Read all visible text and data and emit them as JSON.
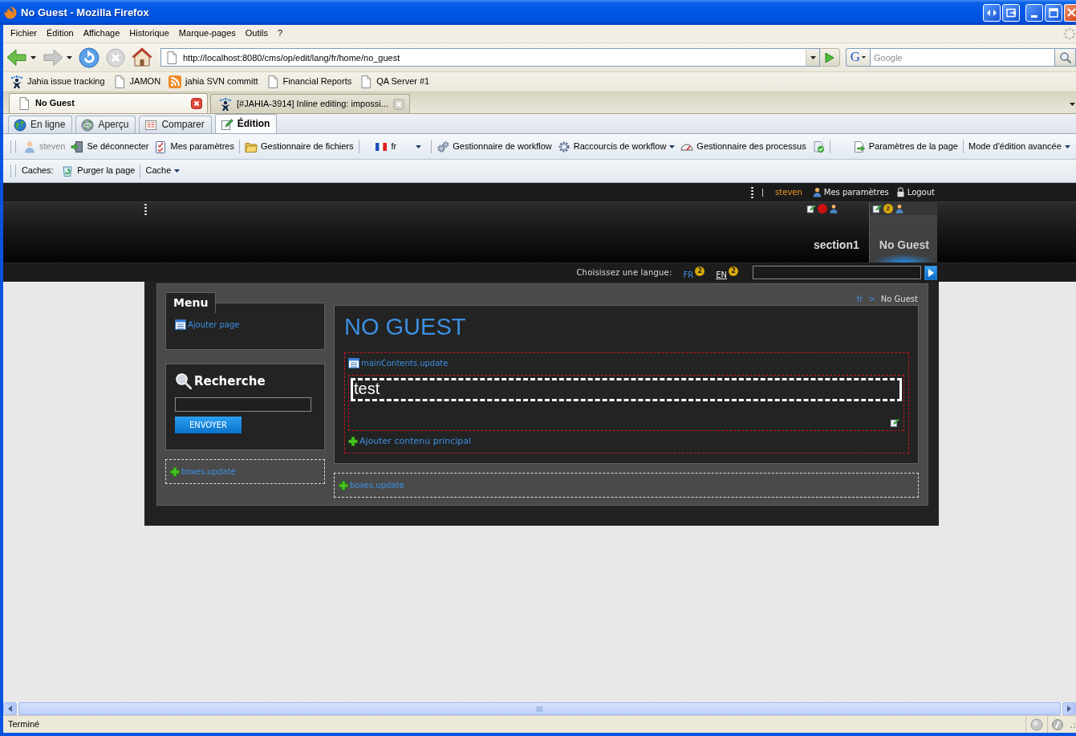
{
  "window": {
    "title": "No Guest - Mozilla Firefox"
  },
  "menu_bar": [
    "Fichier",
    "Édition",
    "Affichage",
    "Historique",
    "Marque-pages",
    "Outils",
    "?"
  ],
  "address_bar": {
    "url": "http://localhost:8080/cms/op/edit/lang/fr/home/no_guest"
  },
  "search_bar": {
    "engine_logo": "G",
    "placeholder": "Google"
  },
  "bookmarks": [
    {
      "label": "Jahia issue tracking",
      "kind": "site"
    },
    {
      "label": "JAMON",
      "kind": "page"
    },
    {
      "label": "jahia SVN committ",
      "kind": "feed"
    },
    {
      "label": "Financial Reports",
      "kind": "page"
    },
    {
      "label": "QA Server #1",
      "kind": "page"
    }
  ],
  "browser_tabs": [
    {
      "label": "No Guest",
      "kind": "page",
      "selected": true
    },
    {
      "label": "[#JAHIA-3914] Inline editing: impossi...",
      "kind": "site",
      "selected": false
    }
  ],
  "mode_tabs": [
    {
      "label": "En ligne",
      "selected": false
    },
    {
      "label": "Aperçu",
      "selected": false
    },
    {
      "label": "Comparer",
      "selected": false
    },
    {
      "label": "Édition",
      "selected": true
    }
  ],
  "edit_toolbar": {
    "groups": [
      {
        "items": [
          {
            "kind": "button",
            "label": "steven",
            "disabled": true
          },
          {
            "kind": "button",
            "label": "Se déconnecter",
            "disabled": false
          },
          {
            "kind": "button",
            "label": "Mes paramètres",
            "disabled": false
          }
        ]
      },
      {
        "items": [
          {
            "kind": "button",
            "label": "Gestionnaire de fichiers",
            "disabled": false
          }
        ]
      },
      {
        "items": [
          {
            "kind": "language",
            "label": "fr",
            "disabled": false
          }
        ]
      },
      {
        "items": [
          {
            "kind": "button",
            "label": "Gestionnaire de workflow",
            "disabled": false
          },
          {
            "kind": "menu",
            "label": "Raccourcis de workflow",
            "disabled": false
          },
          {
            "kind": "button",
            "label": "Gestionnaire des processus",
            "disabled": false
          },
          {
            "kind": "icon",
            "disabled": false
          }
        ]
      },
      {
        "items": [
          {
            "kind": "button",
            "label": "Paramètres de la page",
            "disabled": false
          }
        ]
      },
      {
        "items": [
          {
            "kind": "menu",
            "label": "Mode d'édition avancée",
            "disabled": false
          }
        ]
      }
    ]
  },
  "cache_toolbar": {
    "label": "Caches:",
    "items": [
      {
        "kind": "button",
        "label": "Purger la page"
      },
      {
        "kind": "menu",
        "label": "Cache"
      }
    ]
  },
  "page": {
    "user_bar": {
      "username": "steven",
      "links": [
        "Mes paramètres",
        "Logout"
      ]
    },
    "nav": [
      {
        "label": "section1",
        "selected": false,
        "color": "#cc1111"
      },
      {
        "label": "No Guest",
        "selected": true,
        "color": "#d9a90a",
        "count": "2"
      }
    ],
    "language_bar": {
      "label": "Choisissez une langue:",
      "languages": [
        {
          "code": "FR",
          "count": "2",
          "selected": true
        },
        {
          "code": "EN",
          "count": "2",
          "selected": false
        }
      ]
    },
    "sidebar": {
      "menu_title": "Menu",
      "menu_link": "Ajouter page",
      "search_title": "Recherche",
      "search_button": "ENVOYER",
      "add_link": "boxes.update"
    },
    "breadcrumb": {
      "items": [
        "fr",
        "No Guest"
      ],
      "separator": ">"
    },
    "main": {
      "title": "NO GUEST",
      "area_link": "mainContents.update",
      "content": "test",
      "add_link": "Ajouter contenu principal"
    },
    "bottom_add_link": "boxes.update"
  },
  "status_bar": {
    "text": "Terminé"
  }
}
